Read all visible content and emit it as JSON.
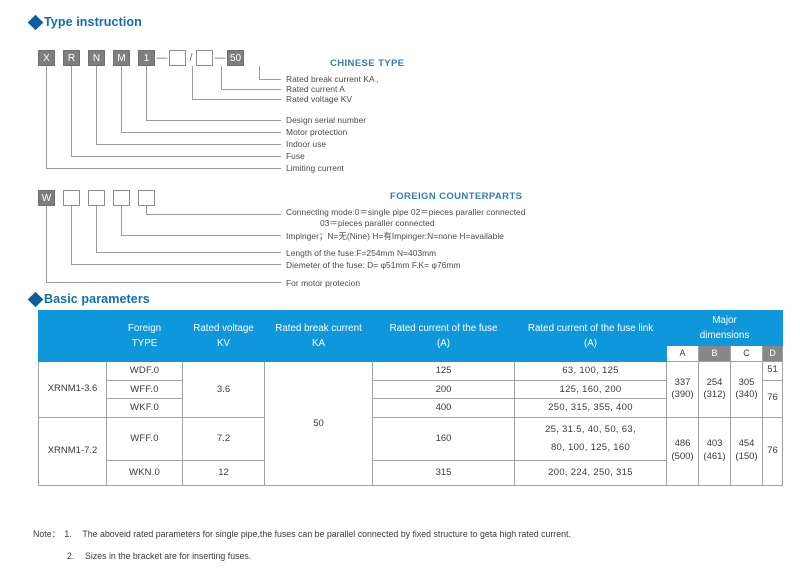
{
  "sections": {
    "type_instruction": "Type instruction",
    "basic_parameters": "Basic parameters"
  },
  "chinese_type": {
    "title": "CHINESE TYPE",
    "boxes": [
      {
        "text": "X",
        "style": "filled"
      },
      {
        "text": "R",
        "style": "filled"
      },
      {
        "text": "N",
        "style": "filled"
      },
      {
        "text": "M",
        "style": "filled"
      },
      {
        "text": "1",
        "style": "filled"
      },
      {
        "text": "",
        "style": "empty"
      },
      {
        "text": "",
        "style": "empty"
      },
      {
        "text": "50",
        "style": "filled"
      }
    ],
    "separators": {
      "dash": "—",
      "slash": "/"
    },
    "labels": [
      "Rated break current KA  ,",
      "Rated current  A",
      "Rated voltage KV",
      "Design serial number",
      "Motor protection",
      "Indoor use",
      "Fuse",
      "Limiting current"
    ]
  },
  "foreign_counterparts": {
    "title": "FOREIGN COUNTERPARTS",
    "boxes": [
      {
        "text": "W",
        "style": "filled"
      },
      {
        "text": "",
        "style": "empty"
      },
      {
        "text": "",
        "style": "empty"
      },
      {
        "text": "",
        "style": "empty"
      },
      {
        "text": "",
        "style": "empty"
      }
    ],
    "labels": [
      "Connecting mode:0＝single pipe 02＝pieces paraller connected",
      "03＝pieces paraller connected",
      "Impinger；N=无(Nine)  H=有Impinger:N=none H=available",
      "Length of the fuse:F=254mm  N=403mm",
      "Diemeter of the fuse:  D= φ51mm  F.K= φ76mm",
      "For motor protecion"
    ]
  },
  "table": {
    "headers": {
      "model": "",
      "foreign_type_l1": "Foreign",
      "foreign_type_l2": "TYPE",
      "rated_voltage_l1": "Rated voltage",
      "rated_voltage_l2": "KV",
      "rated_break_current_l1": "Rated break current",
      "rated_break_current_l2": "KA",
      "rated_current_fuse_l1": "Rated current of the fuse",
      "rated_current_fuse_l2": "(A)",
      "rated_current_link_l1": "Rated current of the fuse link",
      "rated_current_link_l2": "(A)",
      "major_dimensions_l1": "Major",
      "major_dimensions_l2": "dimensions",
      "dim_a": "A",
      "dim_b": "B",
      "dim_c": "C",
      "dim_d": "D"
    },
    "groups": [
      {
        "model": "XRNM1-3.6",
        "rated_voltage": "3.6",
        "rated_break_current": "50",
        "dim_a": "337 (390)",
        "dim_b": "254 (312)",
        "dim_c": "305 (340)",
        "dim_d_top": "51",
        "dim_d_bottom": "76",
        "rows": [
          {
            "foreign_type": "WDF.0",
            "rated_current_fuse": "125",
            "fuse_link_line1": "63,  100,  125",
            "fuse_link_line2": ""
          },
          {
            "foreign_type": "WFF.0",
            "rated_current_fuse": "200",
            "fuse_link_line1": "125,  160,  200",
            "fuse_link_line2": ""
          },
          {
            "foreign_type": "WKF.0",
            "rated_current_fuse": "400",
            "fuse_link_line1": "250,  315,  355,  400",
            "fuse_link_line2": ""
          }
        ]
      },
      {
        "model": "XRNM1-7.2",
        "rated_voltage_rows": [
          "7.2",
          "12"
        ],
        "rated_break_current": "50",
        "dim_a": "486 (500)",
        "dim_b": "403 (461)",
        "dim_c": "454 (150)",
        "dim_d": "76",
        "rows": [
          {
            "foreign_type": "WFF.0",
            "rated_voltage": "7.2",
            "rated_current_fuse": "160",
            "fuse_link_line1": "25,  31.5,  40,  50,  63,",
            "fuse_link_line2": "80,  100,  125,  160"
          },
          {
            "foreign_type": "WKN.0",
            "rated_voltage": "12",
            "rated_current_fuse": "315",
            "fuse_link_line1": "200,  224,  250,  315",
            "fuse_link_line2": ""
          }
        ]
      }
    ]
  },
  "notes": {
    "lead": "Note：",
    "items": [
      {
        "num": "1.",
        "text": "The aboveid rated parameters for single pipe,the fuses can be parallel connected by fixed structure to geta high rated current."
      },
      {
        "num": "2.",
        "text": "Sizes in the bracket are for inserting fuses."
      }
    ]
  },
  "colors": {
    "header_blue": "#0f97dc",
    "heading_text": "#0f6fae",
    "diamond": "#0b5f9e",
    "box_fill": "#7e7e7e",
    "line": "#9b9b9b"
  }
}
